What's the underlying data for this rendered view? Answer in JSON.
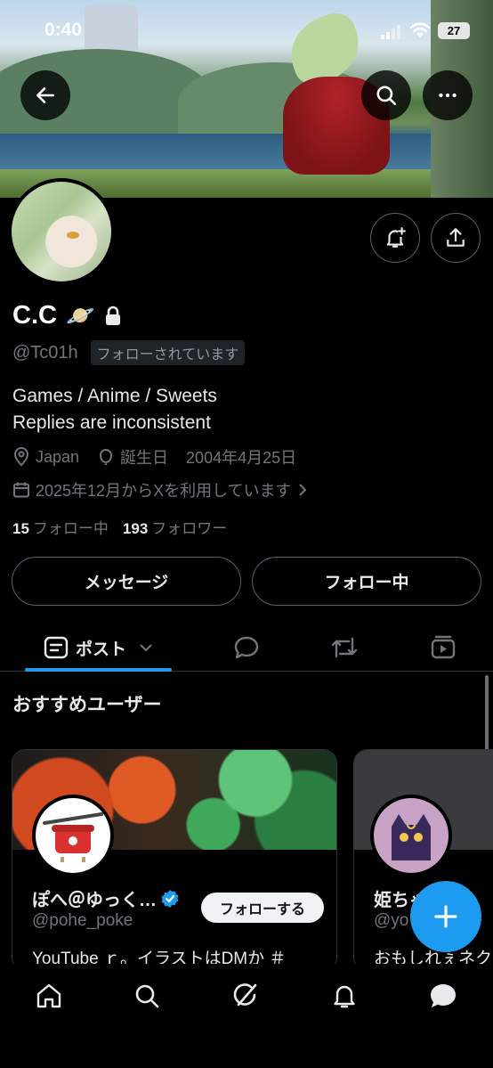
{
  "status_bar": {
    "time": "0:40",
    "battery": "27"
  },
  "profile": {
    "name": "C.C",
    "name_emoji": "🪐",
    "handle": "@Tc01h",
    "follows_you_badge": "フォローされています",
    "bio_line1": "Games / Anime / Sweets",
    "bio_line2": "Replies are inconsistent",
    "location": "Japan",
    "birthday_label": "誕生日",
    "birthday": "2004年4月25日",
    "joined": "2025年12月からXを利用しています",
    "following_count": "15",
    "following_label": "フォロー中",
    "followers_count": "193",
    "followers_label": "フォロワー"
  },
  "actions": {
    "message": "メッセージ",
    "following": "フォロー中"
  },
  "tabs": {
    "posts": "ポスト"
  },
  "recommend": {
    "title": "おすすめユーザー",
    "cards": [
      {
        "name": "ぽへ＠ゆっく…",
        "handle": "@pohe_poke",
        "desc": "YouTube ｒ。イラストはDMか ＃",
        "follow": "フォローする"
      },
      {
        "name": "姫ちゃ",
        "handle": "@yo",
        "desc": "おもしれぇネク"
      }
    ]
  },
  "colors": {
    "accent": "#1d9bf0",
    "background": "#000000",
    "muted": "#71767b"
  }
}
